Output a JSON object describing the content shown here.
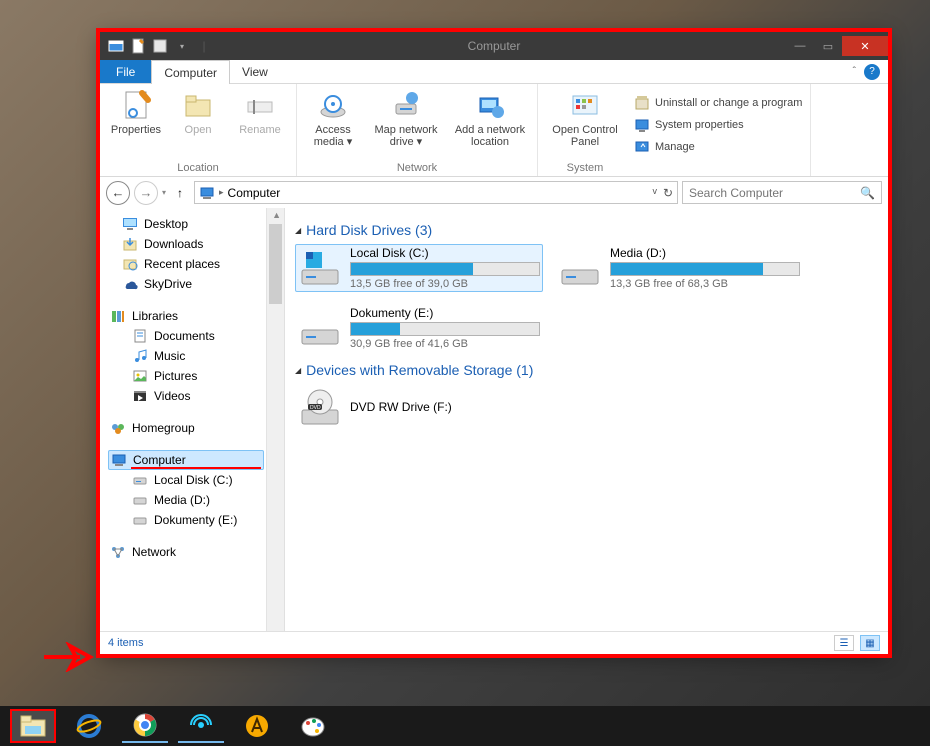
{
  "window": {
    "title": "Computer",
    "controls": {
      "min": "—",
      "max": "▭",
      "close": "✕"
    }
  },
  "ribbon_tabs": {
    "file": "File",
    "computer": "Computer",
    "view": "View"
  },
  "ribbon": {
    "location": {
      "properties": "Properties",
      "open": "Open",
      "rename": "Rename",
      "label": "Location"
    },
    "network": {
      "access_media": "Access media ▾",
      "map_drive": "Map network drive ▾",
      "add_location": "Add a network location",
      "label": "Network"
    },
    "system": {
      "control_panel": "Open Control Panel",
      "uninstall": "Uninstall or change a program",
      "properties": "System properties",
      "manage": "Manage",
      "label": "System"
    }
  },
  "address": {
    "crumb": "Computer"
  },
  "search": {
    "placeholder": "Search Computer"
  },
  "nav": {
    "favorites": {
      "desktop": "Desktop",
      "downloads": "Downloads",
      "recent": "Recent places",
      "skydrive": "SkyDrive"
    },
    "libraries": {
      "label": "Libraries",
      "documents": "Documents",
      "music": "Music",
      "pictures": "Pictures",
      "videos": "Videos"
    },
    "homegroup": "Homegroup",
    "computer": {
      "label": "Computer",
      "c": "Local Disk (C:)",
      "d": "Media (D:)",
      "e": "Dokumenty (E:)"
    },
    "network": "Network"
  },
  "groups": {
    "hdd": "Hard Disk Drives (3)",
    "removable": "Devices with Removable Storage (1)"
  },
  "drives": {
    "c": {
      "name": "Local Disk (C:)",
      "free": "13,5 GB free of 39,0 GB",
      "fill": 65
    },
    "d": {
      "name": "Media (D:)",
      "free": "13,3 GB free of 68,3 GB",
      "fill": 81
    },
    "e": {
      "name": "Dokumenty (E:)",
      "free": "30,9 GB free of 41,6 GB",
      "fill": 26
    }
  },
  "removable": {
    "f": {
      "name": "DVD RW Drive (F:)"
    }
  },
  "status": {
    "items": "4 items"
  }
}
